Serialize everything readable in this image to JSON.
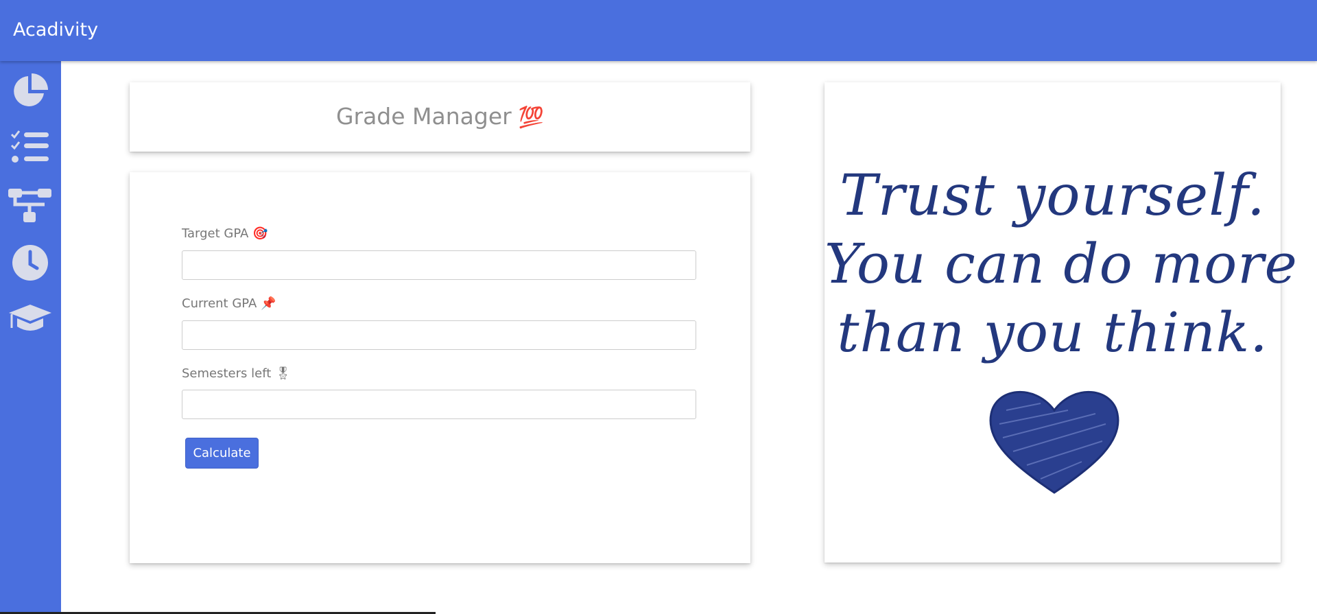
{
  "app": {
    "name": "Acadivity"
  },
  "sidebar": {
    "items": [
      {
        "icon": "pie-chart-icon"
      },
      {
        "icon": "checklist-icon"
      },
      {
        "icon": "sitemap-icon"
      },
      {
        "icon": "clock-icon"
      },
      {
        "icon": "graduation-cap-icon"
      }
    ]
  },
  "page": {
    "title": "Grade Manager",
    "title_emoji": "💯"
  },
  "form": {
    "target_gpa": {
      "label": "Target GPA",
      "emoji": "🎯",
      "value": ""
    },
    "current_gpa": {
      "label": "Current GPA",
      "emoji": "📌",
      "value": ""
    },
    "semesters_left": {
      "label": "Semesters left",
      "emoji": "🎖",
      "value": ""
    },
    "calculate_label": "Calculate"
  },
  "quote": {
    "lines": [
      "Trust yourself.",
      "You can do more",
      "than you think."
    ],
    "decoration": "heart-scribble"
  },
  "colors": {
    "primary": "#4a6fde",
    "sidebar_icon": "#d9dcea",
    "quote_text": "#23387e"
  }
}
